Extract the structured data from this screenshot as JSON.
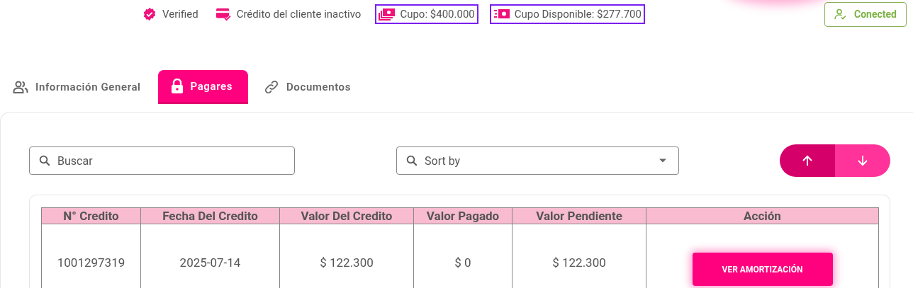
{
  "status": [
    {
      "kind": "verified",
      "label": "Verified",
      "outlined": false
    },
    {
      "kind": "card",
      "label": "Crédito del cliente inactivo",
      "outlined": false
    },
    {
      "kind": "money-stack",
      "label": "Cupo: $400.000",
      "outlined": true
    },
    {
      "kind": "money",
      "label": "Cupo Disponible: $277.700",
      "outlined": true
    }
  ],
  "connection": {
    "label": "Conected"
  },
  "tabs": [
    {
      "kind": "people",
      "label": "Información General",
      "selected": false
    },
    {
      "kind": "lock",
      "label": "Pagares",
      "selected": true
    },
    {
      "kind": "link",
      "label": "Documentos",
      "selected": false
    }
  ],
  "search": {
    "placeholder": "Buscar"
  },
  "sort": {
    "placeholder": "Sort by"
  },
  "order": [
    {
      "kind": "up",
      "selected": true
    },
    {
      "kind": "down",
      "selected": false
    }
  ],
  "table": {
    "columns": [
      "N° Credito",
      "Fecha Del Credito",
      "Valor Del Credito",
      "Valor Pagado",
      "Valor Pendiente",
      "Acción"
    ],
    "rows": [
      {
        "cells": [
          "1001297319",
          "2025-07-14",
          "$ 122.300",
          "$ 0",
          "$ 122.300"
        ],
        "action": "VER AMORTIZACIÓN"
      }
    ]
  }
}
